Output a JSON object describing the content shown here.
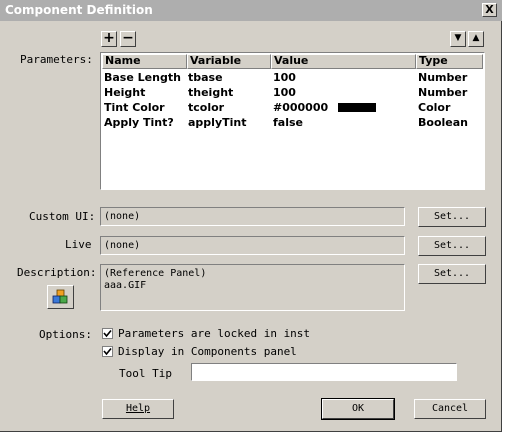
{
  "window": {
    "title": "Component Definition",
    "close_label": "X"
  },
  "parameters": {
    "label": "Parameters:",
    "add_label": "+",
    "remove_label": "−",
    "move_down_label": "▼",
    "move_up_label": "▲",
    "columns": [
      "Name",
      "Variable",
      "Value",
      "Type"
    ],
    "rows": [
      {
        "name": "Base Length",
        "variable": "tbase",
        "value": "100",
        "type": "Number"
      },
      {
        "name": "Height",
        "variable": "theight",
        "value": "100",
        "type": "Number"
      },
      {
        "name": "Tint Color",
        "variable": "tcolor",
        "value": "#000000",
        "type": "Color",
        "swatch_color": "#000000"
      },
      {
        "name": "Apply Tint?",
        "variable": "applyTint",
        "value": "false",
        "type": "Boolean"
      }
    ]
  },
  "custom_ui": {
    "label": "Custom UI:",
    "value": "(none)",
    "button": "Set..."
  },
  "live": {
    "label": "Live",
    "value": "(none)",
    "button": "Set..."
  },
  "description": {
    "label": "Description:",
    "line1": "(Reference Panel)",
    "line2": "aaa.GIF",
    "button": "Set...",
    "icon": "component-icon"
  },
  "options": {
    "label": "Options:",
    "locked_label": "Parameters are locked in inst",
    "locked_checked": true,
    "display_label": "Display in Components panel",
    "display_checked": true,
    "tooltip_label": "Tool Tip",
    "tooltip_value": ""
  },
  "buttons": {
    "help": "Help",
    "ok": "OK",
    "cancel": "Cancel"
  }
}
